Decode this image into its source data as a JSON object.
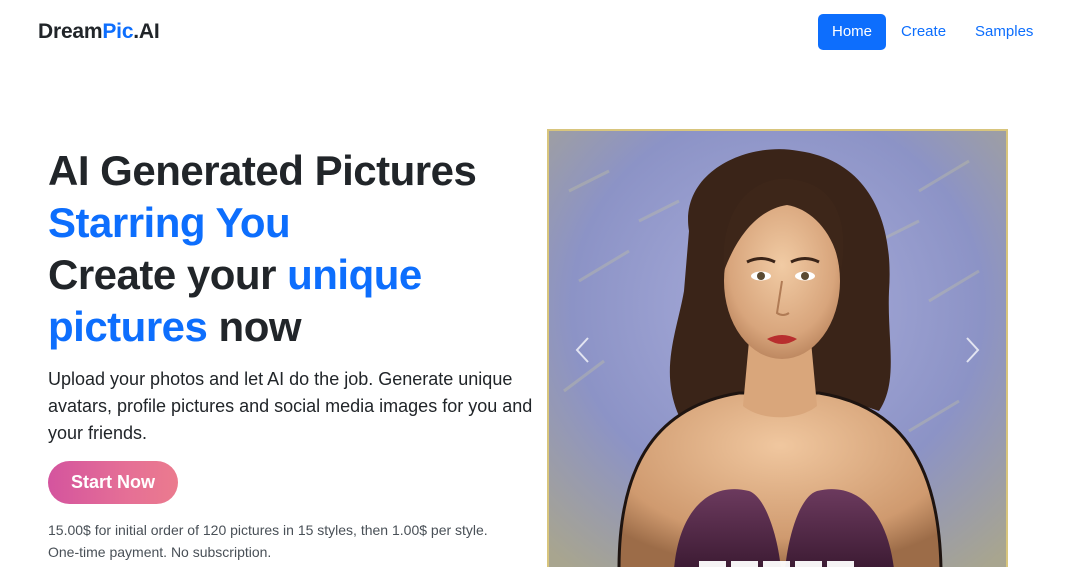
{
  "navbar": {
    "brand_part1": "Dream",
    "brand_part2": "Pic",
    "brand_part3": ".AI",
    "links": [
      {
        "label": "Home",
        "active": true
      },
      {
        "label": "Create",
        "active": false
      },
      {
        "label": "Samples",
        "active": false
      }
    ]
  },
  "hero": {
    "title_line1": "AI Generated Pictures",
    "title_line2": "Starring You",
    "title_line3a": "Create your ",
    "title_line3b": "unique",
    "title_line4a": "pictures",
    "title_line4b": " now",
    "lead": "Upload your photos and let AI do the job. Generate unique avatars, profile pictures and social media images for you and your friends.",
    "cta_label": "Start Now",
    "fineprint_line1": "15.00$ for initial order of 120 pictures in 15 styles, then 1.00$ per style.",
    "fineprint_line2": "One-time payment. No subscription."
  },
  "carousel": {
    "image": "ai-generated-portrait-image",
    "prev_icon": "chevron-left-icon",
    "next_icon": "chevron-right-icon",
    "slide_count": 5,
    "active_slide": 1
  },
  "colors": {
    "accent": "#0d6efd",
    "cta_gradient_start": "#d4549e",
    "cta_gradient_end": "#eb7b8e",
    "frame": "#d8c57d"
  }
}
